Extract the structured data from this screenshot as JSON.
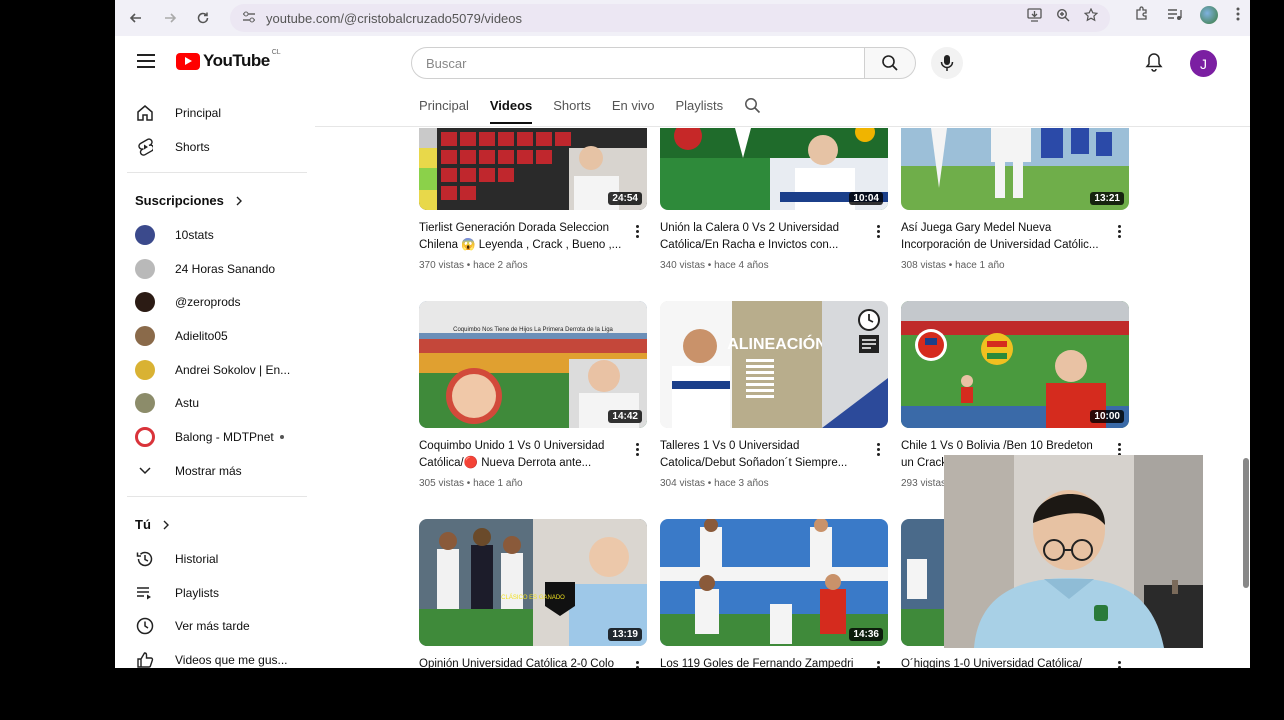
{
  "browser": {
    "url": "youtube.com/@cristobalcruzado5079/videos",
    "icons": [
      "back-icon",
      "forward-icon",
      "reload-icon",
      "site-info-icon",
      "install-icon",
      "zoom-icon",
      "bookmark-star-icon",
      "extensions-icon",
      "media-icon",
      "profile-icon",
      "more-icon"
    ]
  },
  "header": {
    "logo_text": "YouTube",
    "country_code": "CL",
    "search_placeholder": "Buscar",
    "avatar_letter": "J",
    "colors": {
      "brand_red": "#ff0000",
      "avatar_bg": "#7b1fa2"
    }
  },
  "tabs": [
    {
      "label": "Principal",
      "active": false
    },
    {
      "label": "Videos",
      "active": true
    },
    {
      "label": "Shorts",
      "active": false
    },
    {
      "label": "En vivo",
      "active": false
    },
    {
      "label": "Playlists",
      "active": false
    }
  ],
  "sidebar": {
    "main": [
      {
        "label": "Principal",
        "icon": "home-icon"
      },
      {
        "label": "Shorts",
        "icon": "shorts-icon"
      }
    ],
    "subscriptions_heading": "Suscripciones",
    "subscriptions": [
      {
        "label": "10stats",
        "color": "#3b4a8c"
      },
      {
        "label": "24 Horas Sanando",
        "color": "#b9b9b9"
      },
      {
        "label": "@zeroprods",
        "color": "#2b1b14"
      },
      {
        "label": "Adielito05",
        "color": "#8a6a4a"
      },
      {
        "label": "Andrei Sokolov | En...",
        "color": "#d9b233"
      },
      {
        "label": "Astu",
        "color": "#8c8c6a"
      },
      {
        "label": "Balong - MDTPnet",
        "color": "#d9333a"
      }
    ],
    "show_more": "Mostrar más",
    "you_heading": "Tú",
    "you": [
      {
        "label": "Historial",
        "icon": "history-icon"
      },
      {
        "label": "Playlists",
        "icon": "playlists-icon"
      },
      {
        "label": "Ver más tarde",
        "icon": "watch-later-icon"
      },
      {
        "label": "Videos que me gus...",
        "icon": "like-icon"
      }
    ]
  },
  "videos": [
    {
      "title": "Tierlist Generación Dorada Seleccion Chilena 😱 Leyenda , Crack , Bueno ,...",
      "meta": "370 vistas • hace 2 años",
      "duration": "24:54"
    },
    {
      "title": "Unión la Calera 0 Vs 2 Universidad Católica/En Racha e Invictos con...",
      "meta": "340 vistas • hace 4 años",
      "duration": "10:04"
    },
    {
      "title": "Así Juega Gary Medel Nueva Incorporación de Universidad Católic...",
      "meta": "308 vistas • hace 1 año",
      "duration": "13:21"
    },
    {
      "title": "Coquimbo Unido 1 Vs 0 Universidad Católica/🔴 Nueva Derrota ante...",
      "meta": "305 vistas • hace 1 año",
      "duration": "14:42",
      "thumb_text": "Coquimbo Nos Tiene de Hijos La Primera Derrota de la Liga"
    },
    {
      "title": "Talleres 1 Vs 0 Universidad Catolica/Debut Soñadon´t Siempre...",
      "meta": "304 vistas • hace 3 años",
      "duration": "",
      "thumb_text": "ALINEACIÓN"
    },
    {
      "title": "Chile 1 Vs 0 Bolivia /Ben 10 Bredeton un Crack...",
      "meta": "293 vistas",
      "duration": "10:00"
    },
    {
      "title": "Opinión Universidad Católica 2-0 Colo",
      "meta": "",
      "duration": "13:19"
    },
    {
      "title": "Los 119 Goles de Fernando Zampedri",
      "meta": "",
      "duration": "14:36"
    },
    {
      "title": "O´higgins 1-0 Universidad Católica/",
      "meta": "",
      "duration": ""
    }
  ]
}
